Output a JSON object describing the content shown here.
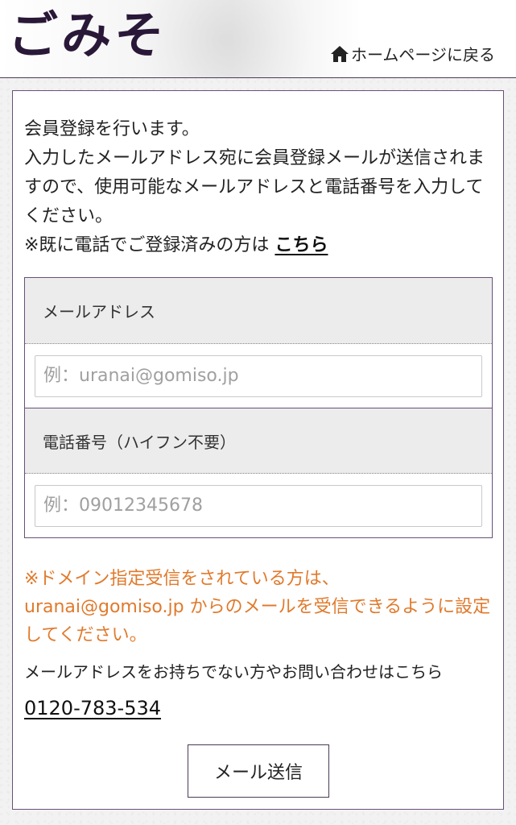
{
  "header": {
    "logo": "ごみそ",
    "home_link": "ホームページに戻る",
    "home_icon": "home-icon"
  },
  "intro": {
    "line1": "会員登録を行います。",
    "line2": "入力したメールアドレス宛に会員登録メールが送信されますので、使用可能なメールアドレスと電話番号を入力してください。",
    "line3_prefix": "※既に電話でご登録済みの方は ",
    "line3_link": "こちら"
  },
  "form": {
    "email_label": "メールアドレス",
    "email_placeholder": "例：uranai@gomiso.jp",
    "email_value": "",
    "phone_label": "電話番号（ハイフン不要）",
    "phone_placeholder": "例：09012345678",
    "phone_value": ""
  },
  "notice": "※ドメイン指定受信をされている方は、uranai@gomiso.jp からのメールを受信できるように設定してください。",
  "contact": {
    "text": "メールアドレスをお持ちでない方やお問い合わせはこちら",
    "phone": "0120-783-534"
  },
  "submit_label": "メール送信",
  "colors": {
    "brand": "#2a1838",
    "border": "#6a4f78",
    "notice": "#e07a2c",
    "label_bg": "#ececec"
  }
}
